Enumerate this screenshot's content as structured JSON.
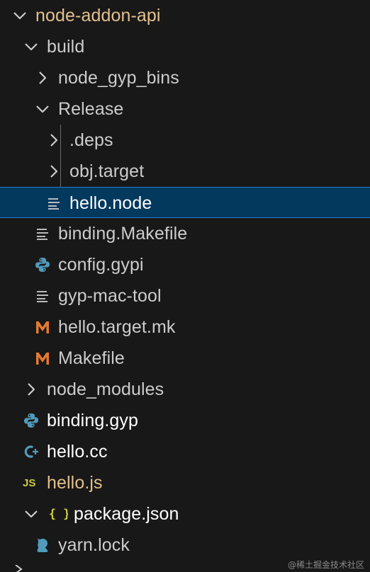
{
  "colors": {
    "background": "#181818",
    "text": "#cccccc",
    "folder_root_text": "#e2c08d",
    "selection_bg": "#04395e",
    "selection_border": "#2b79d0",
    "python_icon": "#519aba",
    "makefile_icon": "#e37933",
    "js_icon": "#cbcb41",
    "json_icon": "#cbcb41",
    "cpp_icon": "#519aba",
    "yarn_icon": "#519aba",
    "lines_icon": "#cccccc",
    "js_text": "#e2c08d"
  },
  "tree": {
    "items": [
      {
        "name": "node-addon-api",
        "icon": "chevron-down-icon",
        "kind": "folder-expanded",
        "depth": 0,
        "color": "#e2c08d"
      },
      {
        "name": "build",
        "icon": "chevron-down-icon",
        "kind": "folder-expanded",
        "depth": 1
      },
      {
        "name": "node_gyp_bins",
        "icon": "chevron-right-icon",
        "kind": "folder-collapsed",
        "depth": 2
      },
      {
        "name": "Release",
        "icon": "chevron-down-icon",
        "kind": "folder-expanded",
        "depth": 2
      },
      {
        "name": ".deps",
        "icon": "chevron-right-icon",
        "kind": "folder-collapsed",
        "depth": 3
      },
      {
        "name": "obj.target",
        "icon": "chevron-right-icon",
        "kind": "folder-collapsed",
        "depth": 3
      },
      {
        "name": "hello.node",
        "icon": "text-lines-icon",
        "kind": "file",
        "depth": 3,
        "selected": true
      },
      {
        "name": "binding.Makefile",
        "icon": "text-lines-icon",
        "kind": "file",
        "depth": 2
      },
      {
        "name": "config.gypi",
        "icon": "python-icon",
        "kind": "file",
        "depth": 2
      },
      {
        "name": "gyp-mac-tool",
        "icon": "text-lines-icon",
        "kind": "file",
        "depth": 2
      },
      {
        "name": "hello.target.mk",
        "icon": "makefile-m-icon",
        "kind": "file",
        "depth": 2
      },
      {
        "name": "Makefile",
        "icon": "makefile-m-icon",
        "kind": "file",
        "depth": 2
      },
      {
        "name": "node_modules",
        "icon": "chevron-right-icon",
        "kind": "folder-collapsed",
        "depth": 1
      },
      {
        "name": "binding.gyp",
        "icon": "python-icon",
        "kind": "file",
        "depth": 1,
        "bright": true
      },
      {
        "name": "hello.cc",
        "icon": "cpp-icon",
        "kind": "file",
        "depth": 1,
        "bright": true
      },
      {
        "name": "hello.js",
        "icon": "js-icon",
        "kind": "file",
        "depth": 1,
        "color": "#e2c08d"
      },
      {
        "name": "package.json",
        "icon": "json-braces-icon",
        "kind": "file",
        "depth": 1,
        "chevron": "chevron-down-icon",
        "bright": true
      },
      {
        "name": "yarn.lock",
        "icon": "yarn-cat-icon",
        "kind": "file",
        "depth": 2
      }
    ],
    "js_badge": "JS",
    "json_badge": "{ }",
    "makefile_badge": "M"
  },
  "watermark": "@稀土掘金技术社区"
}
